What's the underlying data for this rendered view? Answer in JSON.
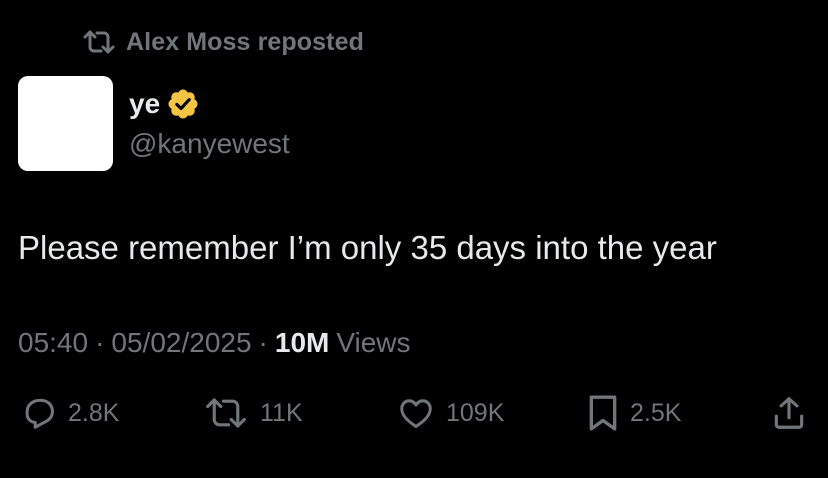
{
  "repost_banner": {
    "text": "Alex Moss reposted",
    "icon": "repost-icon"
  },
  "author": {
    "display_name": "ye",
    "handle": "@kanyewest",
    "verified": true,
    "verified_color": "#f4c542",
    "avatar_color": "#ffffff"
  },
  "tweet": {
    "text": "Please remember I’m only 35 days into the year"
  },
  "meta": {
    "time": "05:40",
    "separator": "·",
    "date": "05/02/2025",
    "views_count": "10M",
    "views_label": "Views"
  },
  "actions": {
    "replies": "2.8K",
    "reposts": "11K",
    "likes": "109K",
    "bookmarks": "2.5K"
  },
  "colors": {
    "background": "#000000",
    "primary_text": "#e7e9ea",
    "secondary_text": "#71767b"
  }
}
